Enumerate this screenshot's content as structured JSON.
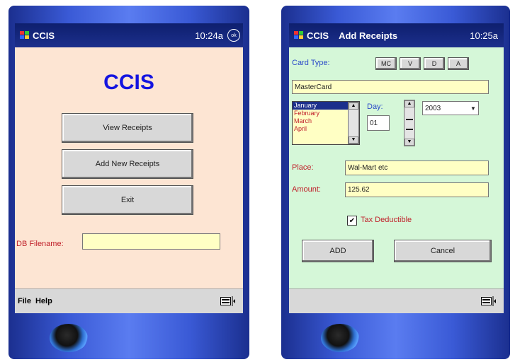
{
  "left_device": {
    "title_bar": {
      "app_name": "CCIS",
      "time": "10:24a",
      "ok_label": "ok"
    },
    "heading": "CCIS",
    "buttons": {
      "view_receipts": "View Receipts",
      "add_new_receipts": "Add New Receipts",
      "exit": "Exit"
    },
    "filename_label": "DB Filename:",
    "filename_value": "",
    "menu": {
      "file": "File",
      "help": "Help"
    }
  },
  "right_device": {
    "title_bar": {
      "app_name": "CCIS",
      "subtitle": "Add Receipts",
      "time": "10:25a"
    },
    "card_type": {
      "label": "Card Type:",
      "options": [
        "MC",
        "V",
        "D",
        "A"
      ]
    },
    "card_name_value": "MasterCard",
    "months": [
      "January",
      "February",
      "March",
      "April"
    ],
    "selected_month": "January",
    "day_label": "Day:",
    "day_value": "01",
    "year_value": "2003",
    "place": {
      "label": "Place:",
      "value": "Wal-Mart etc"
    },
    "amount": {
      "label": "Amount:",
      "value": "125.62"
    },
    "tax_deductible": {
      "label": "Tax Deductible",
      "checked": true
    },
    "buttons": {
      "add": "ADD",
      "cancel": "Cancel"
    }
  }
}
